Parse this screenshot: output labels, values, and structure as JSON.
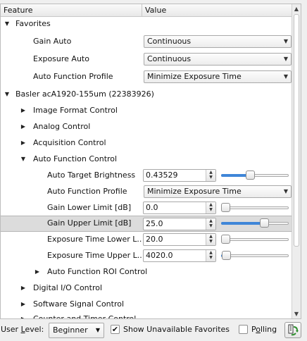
{
  "header": {
    "col_feature": "Feature",
    "col_value": "Value"
  },
  "tree": {
    "favorites": {
      "label": "Favorites",
      "gain_auto": {
        "label": "Gain Auto",
        "value": "Continuous"
      },
      "exposure_auto": {
        "label": "Exposure Auto",
        "value": "Continuous"
      },
      "auto_function_profile": {
        "label": "Auto Function Profile",
        "value": "Minimize Exposure Time"
      }
    },
    "device": {
      "label": "Basler acA1920-155um (22383926)",
      "image_format_control": "Image Format Control",
      "analog_control": "Analog Control",
      "acquisition_control": "Acquisition Control",
      "auto_function_control": {
        "label": "Auto Function Control",
        "auto_target_brightness": {
          "label": "Auto Target Brightness",
          "value": "0.43529",
          "slider": 0.42
        },
        "auto_function_profile": {
          "label": "Auto Function Profile",
          "value": "Minimize Exposure Time"
        },
        "gain_lower_limit": {
          "label": "Gain Lower Limit [dB]",
          "value": "0.0",
          "slider": 0.0
        },
        "gain_upper_limit": {
          "label": "Gain Upper Limit [dB]",
          "value": "25.0",
          "slider": 0.66
        },
        "exposure_time_lower": {
          "label": "Exposure Time Lower L..",
          "value": "20.0",
          "slider": 0.0
        },
        "exposure_time_upper": {
          "label": "Exposure Time Upper L..",
          "value": "4020.0",
          "slider": 0.01
        },
        "roi_control": "Auto Function ROI Control"
      },
      "digital_io_control": "Digital I/O Control",
      "software_signal_control": "Software Signal Control",
      "counter_timer_control": "Counter and Timer Control"
    }
  },
  "bottom": {
    "user_level_label_pre": "User ",
    "user_level_label_u": "L",
    "user_level_label_post": "evel:",
    "user_level_value": "Beginner",
    "show_unavailable": {
      "label": "Show Unavailable Favorites",
      "checked": true
    },
    "polling": {
      "label_pre": "P",
      "label_u": "o",
      "label_post": "lling",
      "checked": false
    }
  },
  "icons": {
    "expanded": "triangle-down-icon",
    "collapsed": "triangle-right-icon",
    "refresh": "refresh-icon"
  },
  "colors": {
    "accent": "#3f86d8",
    "selection": "#dcdcdc"
  }
}
